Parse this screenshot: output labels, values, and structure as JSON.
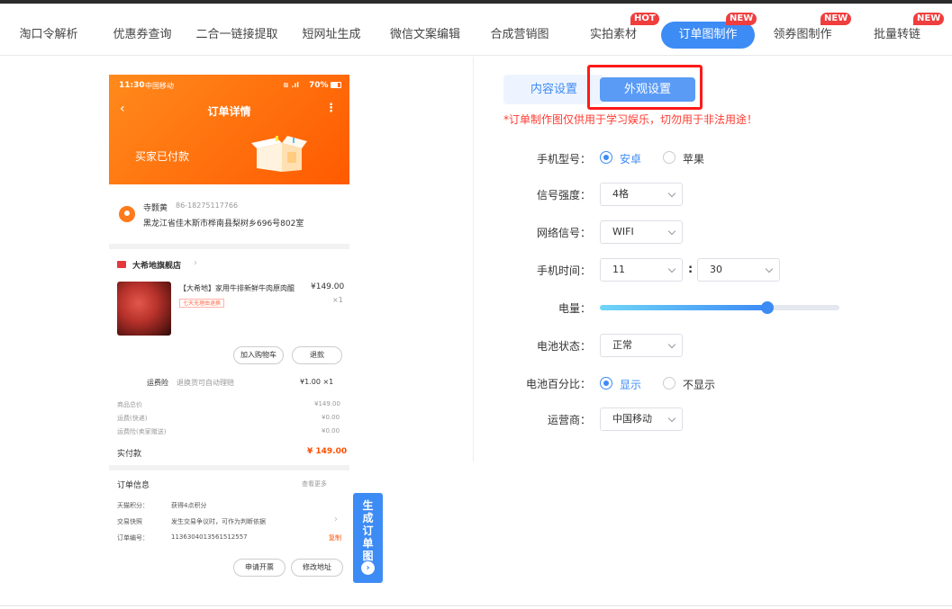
{
  "nav": {
    "items": [
      {
        "label": "淘口令解析"
      },
      {
        "label": "优惠券查询"
      },
      {
        "label": "二合一链接提取"
      },
      {
        "label": "短网址生成"
      },
      {
        "label": "微信文案编辑"
      },
      {
        "label": "合成营销图"
      },
      {
        "label": "实拍素材",
        "badge": "HOT"
      },
      {
        "label": "订单图制作",
        "badge": "NEW",
        "active": true
      },
      {
        "label": "领券图制作",
        "badge": "NEW"
      },
      {
        "label": "批量转链",
        "badge": "NEW"
      }
    ],
    "active_color": "#3d8bf5",
    "badge_color": "#f03e3e"
  },
  "preview": {
    "status_time": "11:30",
    "carrier": "中国移动",
    "battery": "70%",
    "title": "订单详情",
    "paid_status": "买家已付款",
    "receiver_name": "寺颢黄",
    "receiver_phone": "86-18275117766",
    "address": "黑龙江省佳木斯市桦南县梨树乡696号802室",
    "shop_name": "大希地旗舰店",
    "product_title": "【大希地】家用牛排新鲜牛肉原肉醌",
    "product_price": "¥149.00",
    "product_qty": "×1",
    "product_tag": "七天无理由退换",
    "btn_add_cart": "加入购物车",
    "btn_refund": "退款",
    "insurance_label": "运费险",
    "insurance_desc": "退换货可自动理赔",
    "insurance_price": "¥1.00 ×1",
    "goods_total_label": "商品总价",
    "goods_total_value": "¥149.00",
    "shipping_label": "运费(快递)",
    "shipping_value": "¥0.00",
    "shipping_ins_label": "运费险(卖家赠送)",
    "shipping_ins_value": "¥0.00",
    "paid_label": "实付款",
    "paid_value": "¥ 149.00",
    "order_info_title": "订单信息",
    "view_more": "查看更多",
    "points_label": "天猫积分：",
    "points_value": "获得4点积分",
    "snapshot_label": "交易快照",
    "snapshot_value": "发生交易争议时，可作为判断依据",
    "order_no_label": "订单编号：",
    "order_no_value": "1136304013561512557",
    "copy": "复制",
    "btn_invoice": "申请开票",
    "btn_modify_addr": "修改地址",
    "header_color": "#ff6a0a",
    "accent_color": "#ff5000"
  },
  "generate_button": "生成订单图",
  "settings": {
    "tab_content": "内容设置",
    "tab_look": "外观设置",
    "warning": "*订单制作图仅供用于学习娱乐，切勿用于非法用途！",
    "phone_model_label": "手机型号：",
    "phone_model_options": [
      "安卓",
      "苹果"
    ],
    "phone_model_selected": "安卓",
    "signal_label": "信号强度：",
    "signal_value": "4格",
    "network_label": "网络信号：",
    "network_value": "WIFI",
    "time_label": "手机时间：",
    "time_hour": "11",
    "time_minute": "30",
    "battery_label": "电量：",
    "battery_level_fraction": 0.7,
    "battery_status_label": "电池状态：",
    "battery_status_value": "正常",
    "battery_pct_label": "电池百分比：",
    "battery_pct_options": [
      "显示",
      "不显示"
    ],
    "battery_pct_selected": "显示",
    "carrier_label": "运营商：",
    "carrier_value": "中国移动",
    "highlight_color": "#ff1a1a"
  }
}
